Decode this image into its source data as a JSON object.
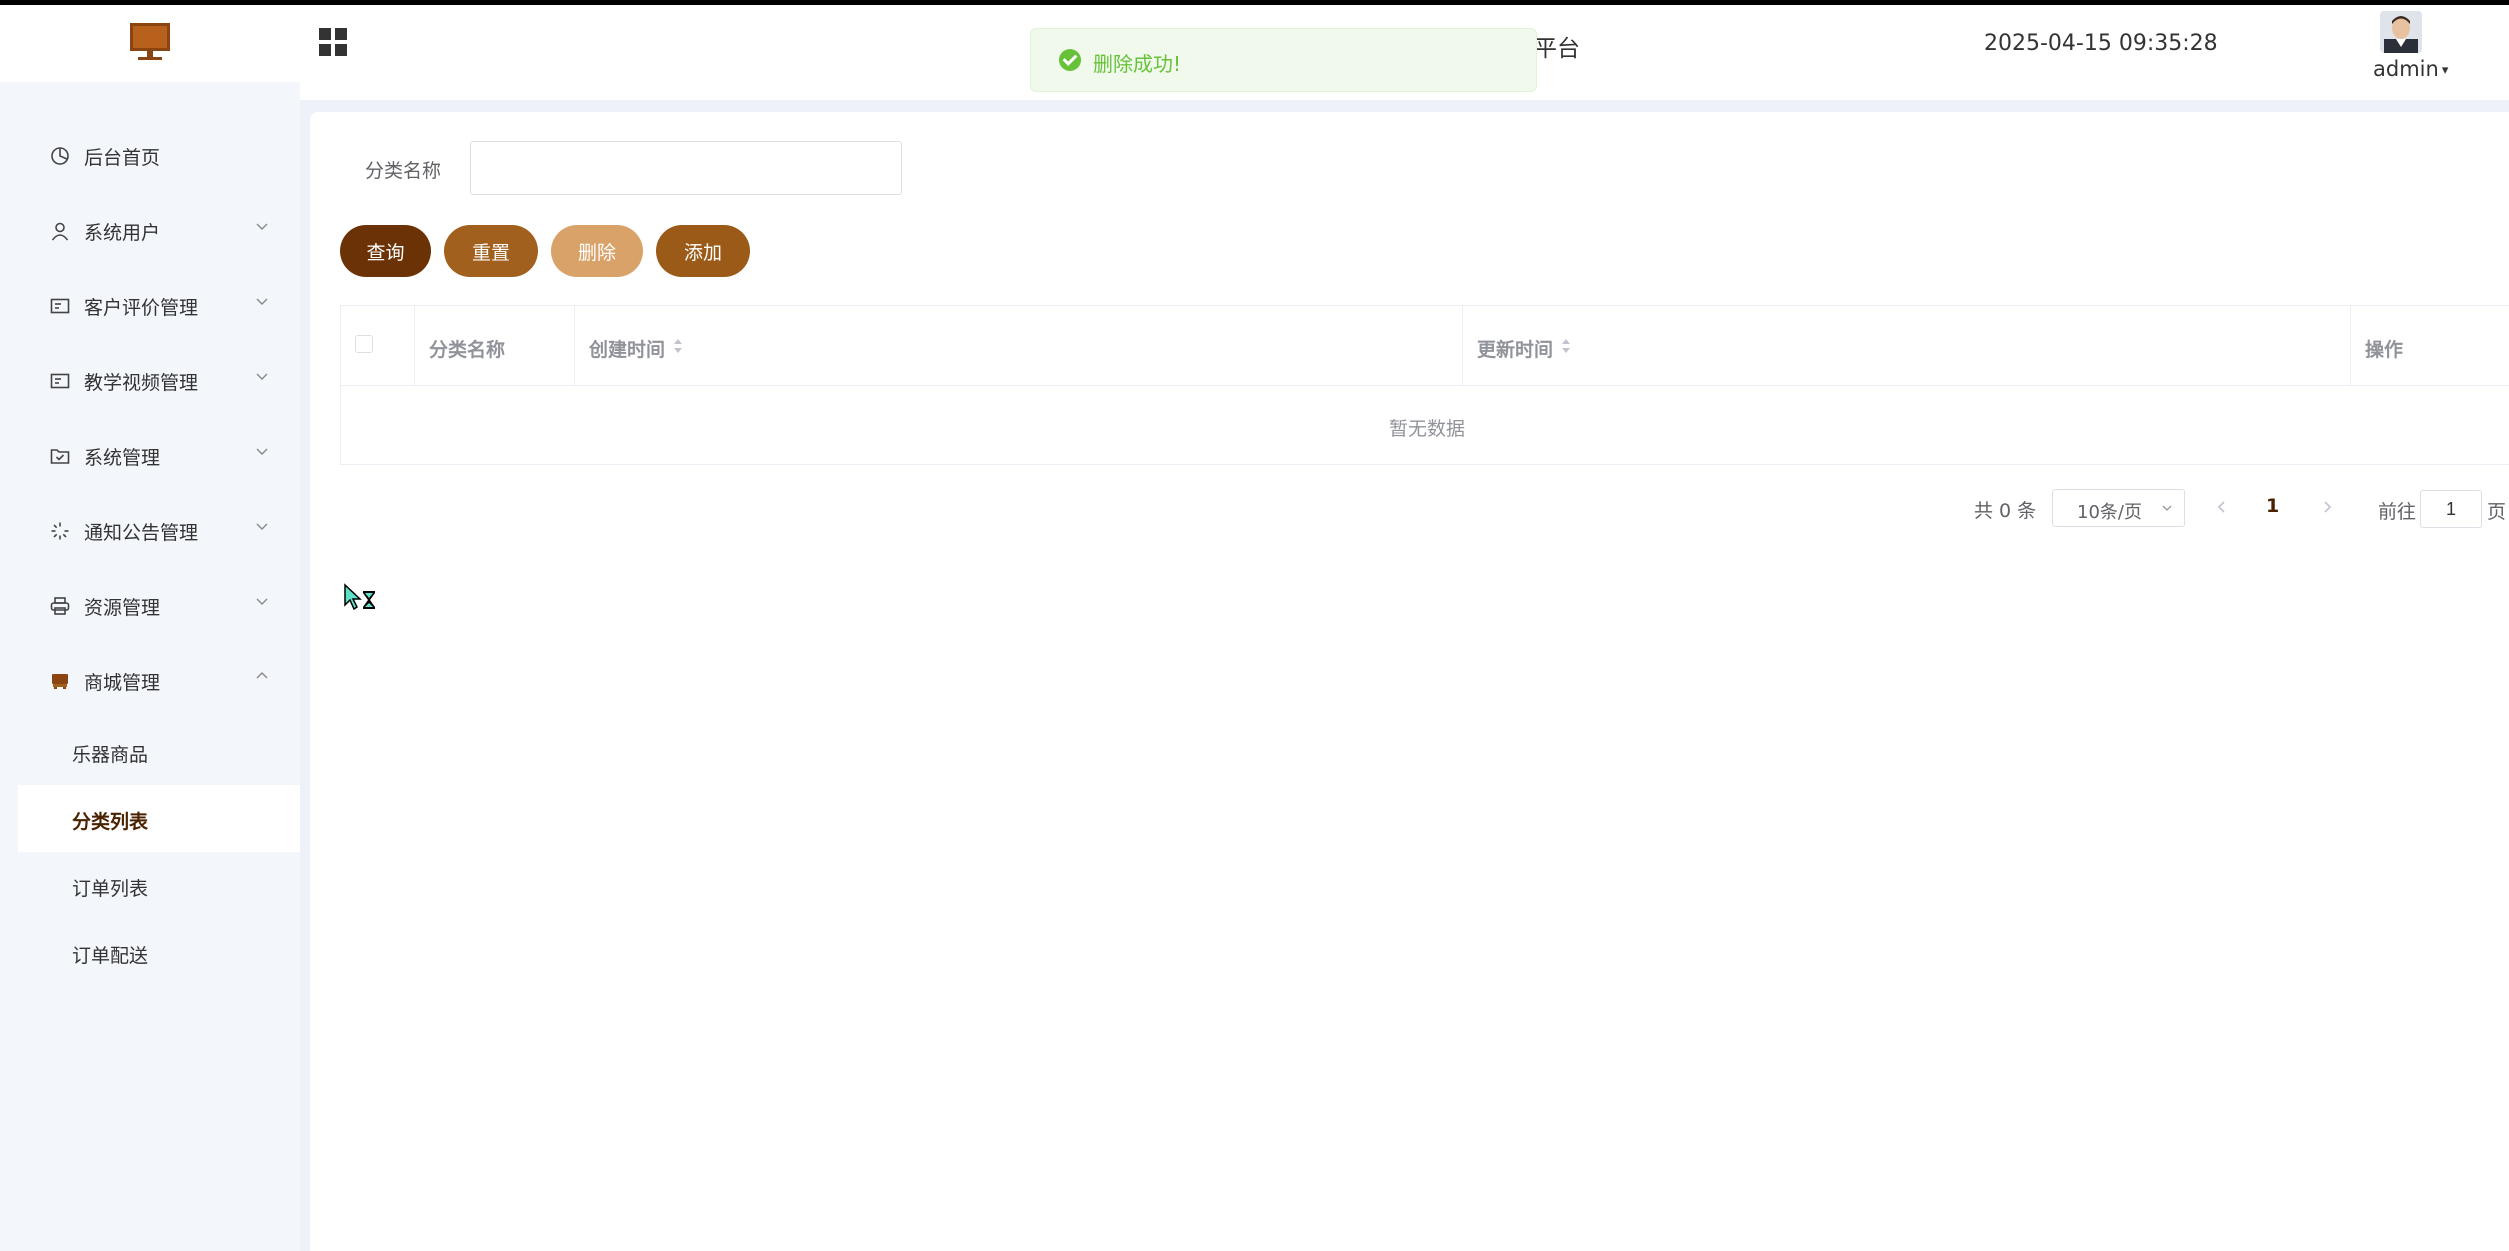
{
  "header": {
    "title_visible": "平台",
    "datetime": "2025-04-15 09:35:28",
    "user": "admin"
  },
  "toast": {
    "message": "删除成功!"
  },
  "sidebar": {
    "items": [
      {
        "label": "后台首页",
        "icon": "pie-chart-icon"
      },
      {
        "label": "系统用户",
        "icon": "user-icon"
      },
      {
        "label": "客户评价管理",
        "icon": "card-icon"
      },
      {
        "label": "教学视频管理",
        "icon": "card-icon"
      },
      {
        "label": "系统管理",
        "icon": "folder-check-icon"
      },
      {
        "label": "通知公告管理",
        "icon": "loading-icon"
      },
      {
        "label": "资源管理",
        "icon": "printer-icon"
      },
      {
        "label": "商城管理",
        "icon": "shop-icon"
      }
    ],
    "subitems": [
      {
        "label": "乐器商品"
      },
      {
        "label": "分类列表",
        "active": true
      },
      {
        "label": "订单列表"
      },
      {
        "label": "订单配送"
      }
    ]
  },
  "search": {
    "label": "分类名称",
    "value": ""
  },
  "buttons": {
    "query": "查询",
    "reset": "重置",
    "delete": "删除",
    "add": "添加"
  },
  "table": {
    "columns": [
      "分类名称",
      "创建时间",
      "更新时间",
      "操作"
    ],
    "empty_text": "暂无数据"
  },
  "pagination": {
    "total": "共 0 条",
    "page_size": "10条/页",
    "current_page": "1",
    "goto_label": "前往",
    "goto_value": "1",
    "goto_suffix": "页"
  },
  "colors": {
    "brand_dark": "#6b3206",
    "brand": "#a2601e",
    "brand_light": "#d9a269",
    "success": "#67c23a",
    "sidebar_bg": "#f3f6fb"
  }
}
